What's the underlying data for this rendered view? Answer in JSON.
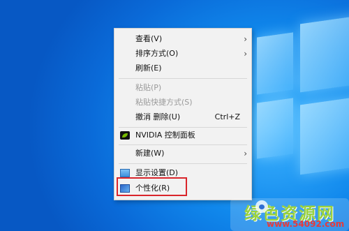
{
  "context_menu": {
    "items": [
      {
        "label": "查看(V)",
        "shortcut": "",
        "submenu": true,
        "enabled": true
      },
      {
        "label": "排序方式(O)",
        "shortcut": "",
        "submenu": true,
        "enabled": true
      },
      {
        "label": "刷新(E)",
        "shortcut": "",
        "submenu": false,
        "enabled": true
      },
      {
        "label": "粘贴(P)",
        "shortcut": "",
        "submenu": false,
        "enabled": false
      },
      {
        "label": "粘贴快捷方式(S)",
        "shortcut": "",
        "submenu": false,
        "enabled": false
      },
      {
        "label": "撤消 删除(U)",
        "shortcut": "Ctrl+Z",
        "submenu": false,
        "enabled": true
      },
      {
        "label": "NVIDIA 控制面板",
        "shortcut": "",
        "submenu": false,
        "enabled": true,
        "icon": "nvidia-icon"
      },
      {
        "label": "新建(W)",
        "shortcut": "",
        "submenu": true,
        "enabled": true
      },
      {
        "label": "显示设置(D)",
        "shortcut": "",
        "submenu": false,
        "enabled": true,
        "icon": "display-settings-icon"
      },
      {
        "label": "个性化(R)",
        "shortcut": "",
        "submenu": false,
        "enabled": true,
        "icon": "personalize-icon",
        "highlighted": true
      }
    ],
    "submenu_arrow": "›"
  },
  "watermark": {
    "title": "绿色资源网",
    "url": "www.54092.com"
  },
  "colors": {
    "desktop": "#0a6ad8",
    "highlight_border": "#d9252b",
    "menu_background": "#f2f2f2"
  }
}
